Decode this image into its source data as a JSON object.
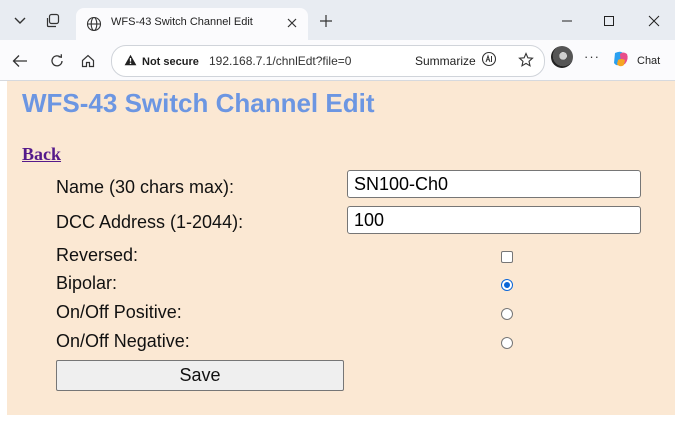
{
  "browser": {
    "tab": {
      "title": "WFS-43 Switch Channel Edit"
    },
    "address": {
      "security_label": "Not secure",
      "url": "192.168.7.1/chnlEdt?file=0"
    },
    "toolbar": {
      "summarize_label": "Summarize",
      "more_label": "···",
      "chat_label": "Chat"
    }
  },
  "page": {
    "title": "WFS-43 Switch Channel Edit",
    "back_label": "Back",
    "fields": {
      "name_label": "Name (30 chars max):",
      "name_value": "SN100-Ch0",
      "dcc_label": "DCC Address (1-2044):",
      "dcc_value": "100",
      "reversed_label": "Reversed:",
      "reversed_checked": false,
      "mode_options": [
        {
          "label": "Bipolar:",
          "selected": true
        },
        {
          "label": "On/Off Positive:",
          "selected": false
        },
        {
          "label": "On/Off Negative:",
          "selected": false
        }
      ]
    },
    "save_label": "Save"
  },
  "colors": {
    "page_background": "#fbe8d3",
    "title_color": "#6c96e2",
    "link_color": "#551a8b",
    "radio_accent": "#0b66d8"
  }
}
